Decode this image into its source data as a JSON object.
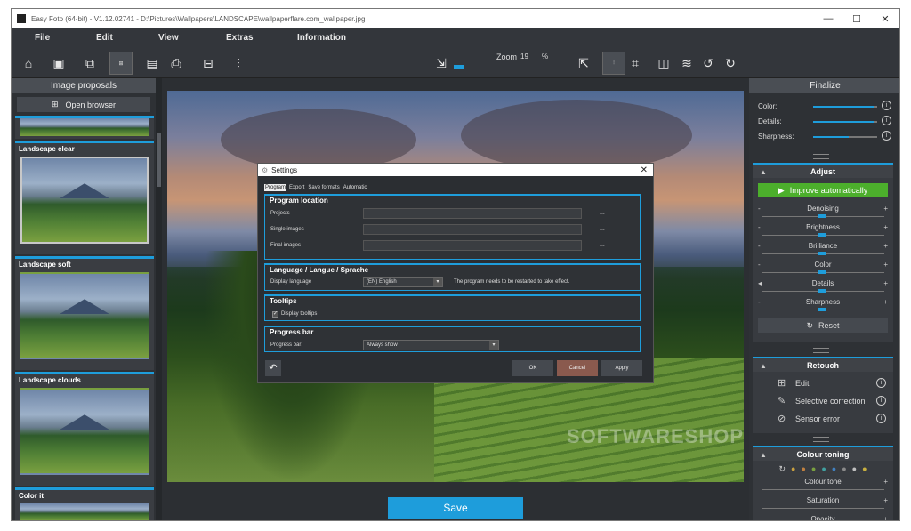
{
  "window": {
    "title": "Easy Foto (64-bit) - V1.12.02741 - D:\\Pictures\\Wallpapers\\LANDSCAPE\\wallpaperflare.com_wallpaper.jpg",
    "controls": [
      "—",
      "☐",
      "✕"
    ]
  },
  "menu": [
    "File",
    "Edit",
    "View",
    "Extras",
    "Information"
  ],
  "toolbar": {
    "zoom_label": "Zoom",
    "zoom_value": "19",
    "zoom_unit": "%",
    "icons": [
      "home-icon",
      "photo-icon",
      "print-stack-icon",
      "browse-icon",
      "save-icon",
      "printer-icon",
      "export-icon",
      "histogram-icon",
      "fit-width-icon",
      "fit-height-icon",
      "compare-icon",
      "crop-icon",
      "flip-icon",
      "rotate-left-icon",
      "rotate-right-icon"
    ]
  },
  "left_panel": {
    "header": "Image proposals",
    "open_browser": "Open browser",
    "proposals": [
      "Landscape clear",
      "Landscape soft",
      "Landscape clouds",
      "Color it"
    ]
  },
  "main": {
    "watermark": "SOFTWARESHOP",
    "save_label": "Save"
  },
  "right_panel": {
    "header": "Finalize",
    "finalize_rows": [
      {
        "label": "Color:",
        "level": 0.95
      },
      {
        "label": "Details:",
        "level": 0.95
      },
      {
        "label": "Sharpness:",
        "level": 0.55
      }
    ],
    "adjust": {
      "title": "Adjust",
      "improve": "Improve automatically",
      "items": [
        "Denoising",
        "Brightness",
        "Brilliance",
        "Color",
        "Details",
        "Sharpness"
      ],
      "reset": "Reset"
    },
    "retouch": {
      "title": "Retouch",
      "items": [
        {
          "label": "Edit",
          "icon": "grid-icon"
        },
        {
          "label": "Selective correction",
          "icon": "eye-dropper-icon"
        },
        {
          "label": "Sensor error",
          "icon": "magnifier-icon"
        }
      ]
    },
    "toning": {
      "title": "Colour toning",
      "items": [
        "Colour tone",
        "Saturation",
        "Opacity"
      ]
    }
  },
  "dialog": {
    "title": "Settings",
    "tabs": [
      "Program",
      "Export",
      "Save formats",
      "Automatic"
    ],
    "program_location": {
      "heading": "Program location",
      "fields": [
        "Projects",
        "Single images",
        "Final images"
      ],
      "browse": "..."
    },
    "language": {
      "heading": "Language / Langue / Sprache",
      "label": "Display language",
      "value": "(EN) English",
      "hint": "The program needs to be restarted to take effect."
    },
    "tooltips": {
      "heading": "Tooltips",
      "label": "Display tooltips",
      "checked": true
    },
    "progress": {
      "heading": "Progress bar",
      "label": "Progress bar:",
      "value": "Always show"
    },
    "buttons": {
      "ok": "OK",
      "cancel": "Cancel",
      "apply": "Apply"
    }
  }
}
